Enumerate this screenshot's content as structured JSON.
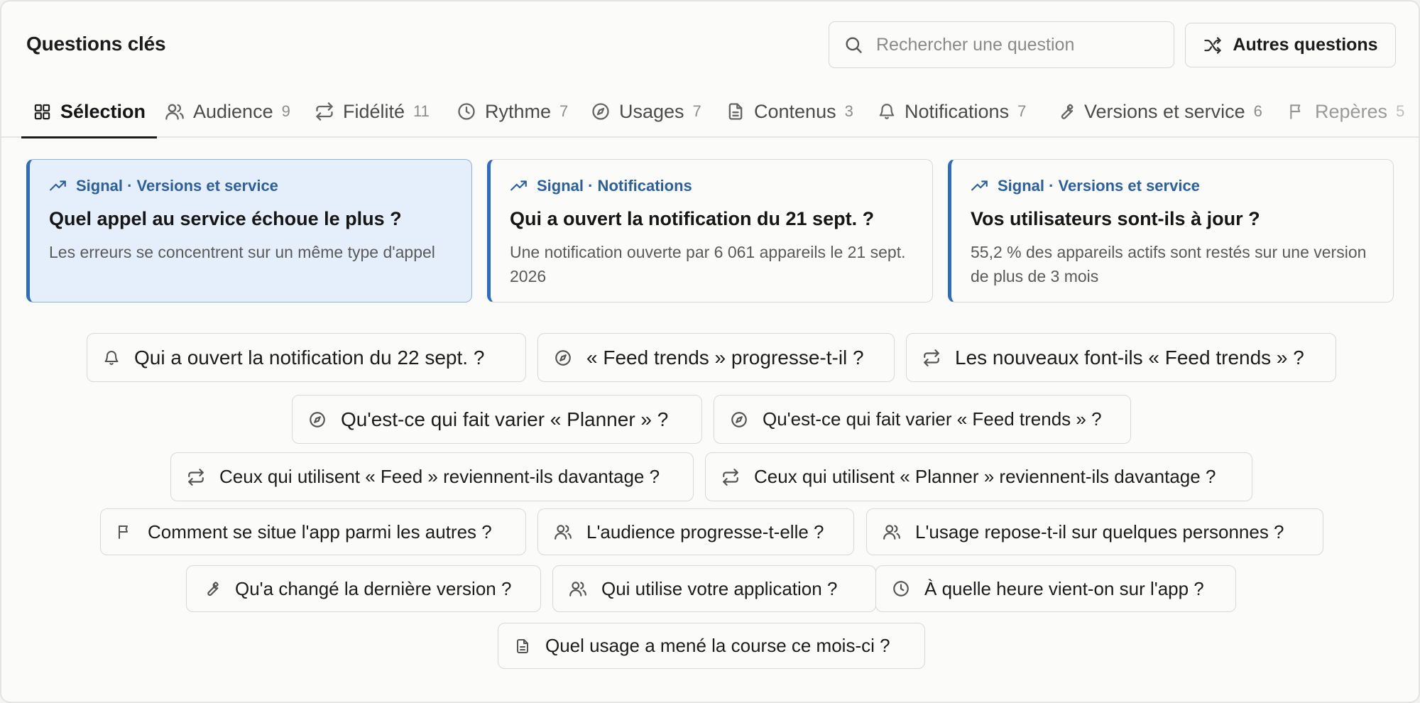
{
  "header": {
    "title": "Questions clés",
    "search_placeholder": "Rechercher une question",
    "more_label": "Autres questions"
  },
  "tabs": [
    {
      "label": "Sélection",
      "count": "",
      "icon": "grid-icon",
      "active": true
    },
    {
      "label": "Audience",
      "count": "9",
      "icon": "users-icon"
    },
    {
      "label": "Fidélité",
      "count": "11",
      "icon": "repeat-icon"
    },
    {
      "label": "Rythme",
      "count": "7",
      "icon": "clock-icon"
    },
    {
      "label": "Usages",
      "count": "7",
      "icon": "compass-icon"
    },
    {
      "label": "Contenus",
      "count": "3",
      "icon": "document-icon"
    },
    {
      "label": "Notifications",
      "count": "7",
      "icon": "bell-icon"
    },
    {
      "label": "Versions et service",
      "count": "6",
      "icon": "wrench-icon"
    },
    {
      "label": "Repères",
      "count": "5",
      "icon": "flag-icon"
    }
  ],
  "signals": [
    {
      "eyebrow": "Signal · Versions et service",
      "heading": "Quel appel au service échoue le plus ?",
      "desc": "Les erreurs se concentrent sur un même type d'appel",
      "highlighted": true
    },
    {
      "eyebrow": "Signal · Notifications",
      "heading": "Qui a ouvert la notification du 21 sept. ?",
      "desc": "Une notification ouverte par 6 061 appareils le 21 sept. 2026"
    },
    {
      "eyebrow": "Signal · Versions et service",
      "heading": "Vos utilisateurs sont-ils à jour ?",
      "desc": "55,2 % des appareils actifs sont restés sur une version de plus de 3 mois"
    }
  ],
  "questions": [
    {
      "label": "Qui a ouvert la notification du 22 sept. ?",
      "icon": "bell-icon"
    },
    {
      "label": "« Feed trends » progresse-t-il ?",
      "icon": "compass-icon"
    },
    {
      "label": "Les nouveaux font-ils « Feed trends » ?",
      "icon": "repeat-icon"
    },
    {
      "label": "Qu'est-ce qui fait varier « Planner » ?",
      "icon": "compass-icon"
    },
    {
      "label": "Qu'est-ce qui fait varier « Feed trends » ?",
      "icon": "compass-icon"
    },
    {
      "label": "Ceux qui utilisent « Feed » reviennent-ils davantage ?",
      "icon": "repeat-icon"
    },
    {
      "label": "Ceux qui utilisent « Planner » reviennent-ils davantage ?",
      "icon": "repeat-icon"
    },
    {
      "label": "Comment se situe l'app parmi les autres ?",
      "icon": "flag-icon"
    },
    {
      "label": "L'audience progresse-t-elle ?",
      "icon": "users-icon"
    },
    {
      "label": "L'usage repose-t-il sur quelques personnes ?",
      "icon": "users-icon"
    },
    {
      "label": "Qu'a changé la dernière version ?",
      "icon": "wrench-icon"
    },
    {
      "label": "Qui utilise votre application ?",
      "icon": "users-icon"
    },
    {
      "label": "À quelle heure vient-on sur l'app ?",
      "icon": "clock-icon"
    },
    {
      "label": "Quel usage a mené la course ce mois-ci ?",
      "icon": "document-icon"
    }
  ],
  "colors": {
    "accent": "#2e6cc2",
    "accent_text": "#2c5f9e",
    "highlight_bg": "#e5effc"
  }
}
